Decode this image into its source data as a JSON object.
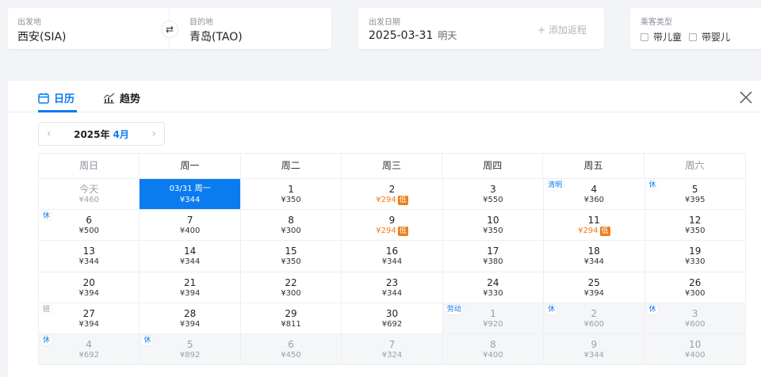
{
  "search": {
    "from_label": "出发地",
    "from_value": "西安(SIA)",
    "to_label": "目的地",
    "to_value": "青岛(TAO)",
    "date_label": "出发日期",
    "date_value": "2025-03-31",
    "date_sub": "明天",
    "add_return": "+ 添加返程",
    "pax_label": "乘客类型",
    "child": "带儿童",
    "infant": "带婴儿"
  },
  "tabs": {
    "calendar": "日历",
    "trend": "趋势"
  },
  "month_nav": {
    "year": "2025年",
    "month": "4月",
    "prev": "‹",
    "next": "›"
  },
  "weekdays": [
    "周日",
    "周一",
    "周二",
    "周三",
    "周四",
    "周五",
    "周六"
  ],
  "weeks": [
    [
      {
        "d": "今天",
        "p": "¥460",
        "state": "today"
      },
      {
        "d": "03/31 周一",
        "p": "¥344",
        "state": "selected"
      },
      {
        "d": "1",
        "p": "¥350"
      },
      {
        "d": "2",
        "p": "¥294",
        "low": "低"
      },
      {
        "d": "3",
        "p": "¥550"
      },
      {
        "d": "4",
        "p": "¥360",
        "tag": "清明"
      },
      {
        "d": "5",
        "p": "¥395",
        "tag": "休"
      }
    ],
    [
      {
        "d": "6",
        "p": "¥500",
        "tag": "休"
      },
      {
        "d": "7",
        "p": "¥400"
      },
      {
        "d": "8",
        "p": "¥300"
      },
      {
        "d": "9",
        "p": "¥294",
        "low": "低"
      },
      {
        "d": "10",
        "p": "¥350"
      },
      {
        "d": "11",
        "p": "¥294",
        "low": "低"
      },
      {
        "d": "12",
        "p": "¥350"
      }
    ],
    [
      {
        "d": "13",
        "p": "¥344"
      },
      {
        "d": "14",
        "p": "¥344"
      },
      {
        "d": "15",
        "p": "¥350"
      },
      {
        "d": "16",
        "p": "¥344"
      },
      {
        "d": "17",
        "p": "¥380"
      },
      {
        "d": "18",
        "p": "¥344"
      },
      {
        "d": "19",
        "p": "¥330"
      }
    ],
    [
      {
        "d": "20",
        "p": "¥394"
      },
      {
        "d": "21",
        "p": "¥394"
      },
      {
        "d": "22",
        "p": "¥300"
      },
      {
        "d": "23",
        "p": "¥344"
      },
      {
        "d": "24",
        "p": "¥330"
      },
      {
        "d": "25",
        "p": "¥394"
      },
      {
        "d": "26",
        "p": "¥300"
      }
    ],
    [
      {
        "d": "27",
        "p": "¥394",
        "tag": "班",
        "tagType": "ban"
      },
      {
        "d": "28",
        "p": "¥394"
      },
      {
        "d": "29",
        "p": "¥811"
      },
      {
        "d": "30",
        "p": "¥692"
      },
      {
        "d": "1",
        "p": "¥920",
        "tag": "劳动",
        "state": "grey"
      },
      {
        "d": "2",
        "p": "¥600",
        "tag": "休",
        "state": "grey"
      },
      {
        "d": "3",
        "p": "¥600",
        "tag": "休",
        "state": "grey"
      }
    ],
    [
      {
        "d": "4",
        "p": "¥692",
        "tag": "休",
        "state": "grey"
      },
      {
        "d": "5",
        "p": "¥892",
        "tag": "休",
        "state": "grey"
      },
      {
        "d": "6",
        "p": "¥450",
        "state": "grey"
      },
      {
        "d": "7",
        "p": "¥324",
        "state": "grey"
      },
      {
        "d": "8",
        "p": "¥400",
        "state": "grey"
      },
      {
        "d": "9",
        "p": "¥344",
        "state": "grey"
      },
      {
        "d": "10",
        "p": "¥400",
        "state": "grey"
      }
    ]
  ],
  "colors": {
    "accent": "#0a7cf0",
    "low_price": "#f07c1a"
  }
}
